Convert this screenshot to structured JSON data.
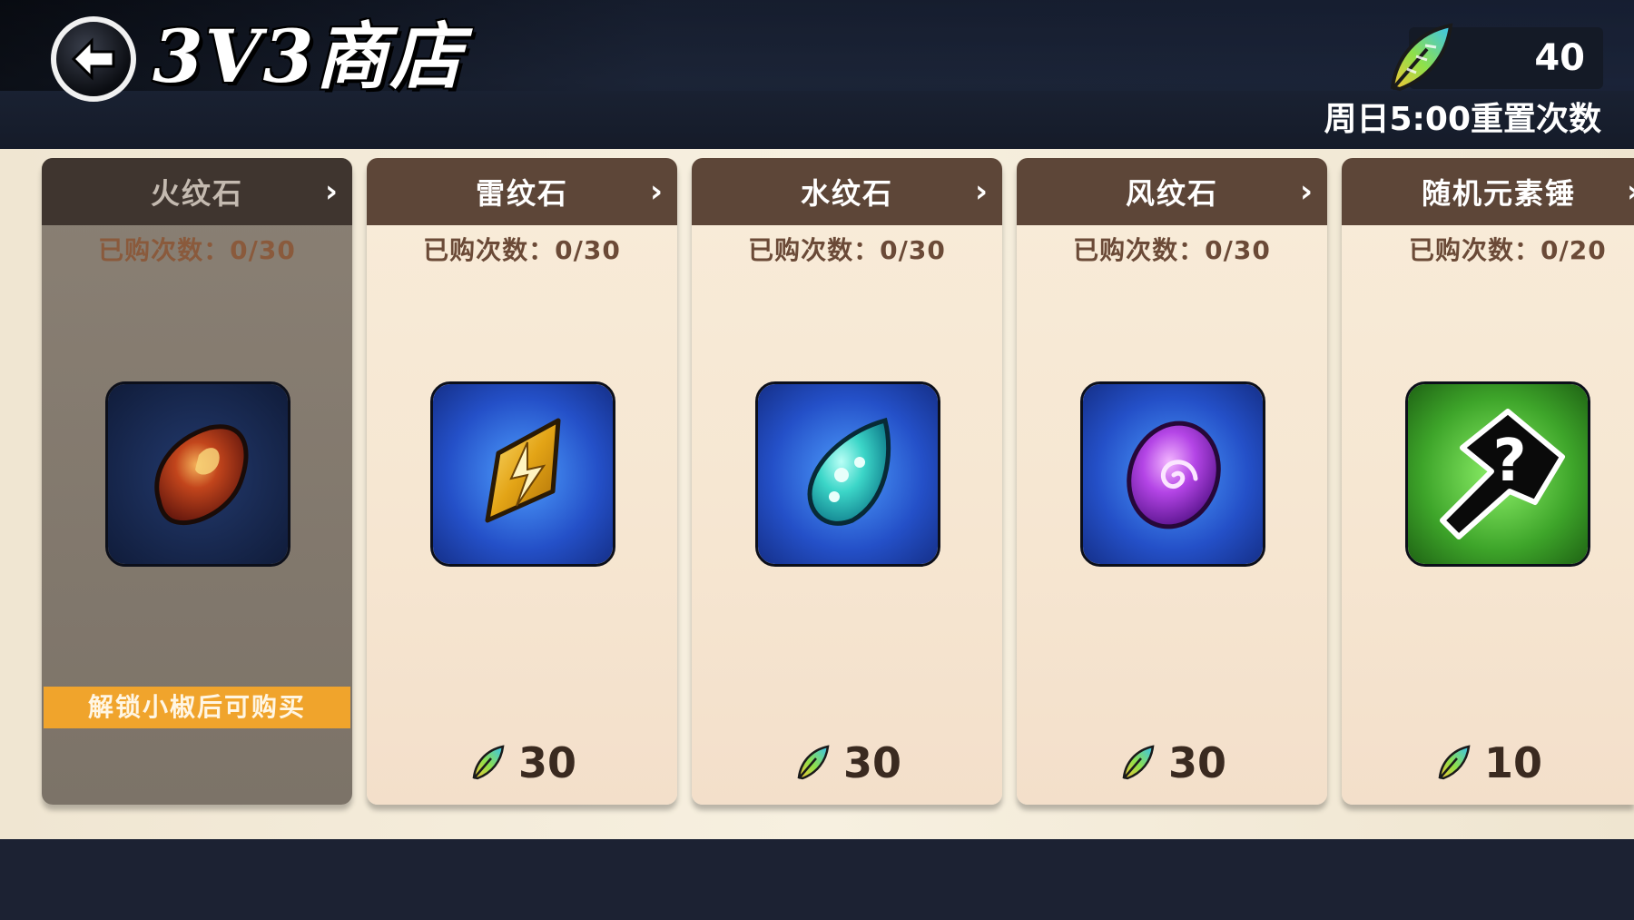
{
  "header": {
    "title": "3V3商店",
    "currency_amount": "40",
    "reset_note": "周日5:00重置次数"
  },
  "items": [
    {
      "name": "火纹石",
      "count": "已购次数：0/30",
      "locked": true,
      "lock_text": "解锁小椒后可购买",
      "icon": "fire-stone-icon"
    },
    {
      "name": "雷纹石",
      "count": "已购次数：0/30",
      "price": "30",
      "icon": "thunder-stone-icon"
    },
    {
      "name": "水纹石",
      "count": "已购次数：0/30",
      "price": "30",
      "icon": "water-stone-icon"
    },
    {
      "name": "风纹石",
      "count": "已购次数：0/30",
      "price": "30",
      "icon": "wind-stone-icon"
    },
    {
      "name": "随机元素锤",
      "count": "已购次数：0/20",
      "price": "10",
      "icon": "random-element-hammer-icon"
    }
  ],
  "colors": {
    "header_bg": "#1a2233",
    "card_bg": "#f6e6d1",
    "card_header": "#5d4638",
    "lock_banner": "#f0a42c"
  }
}
